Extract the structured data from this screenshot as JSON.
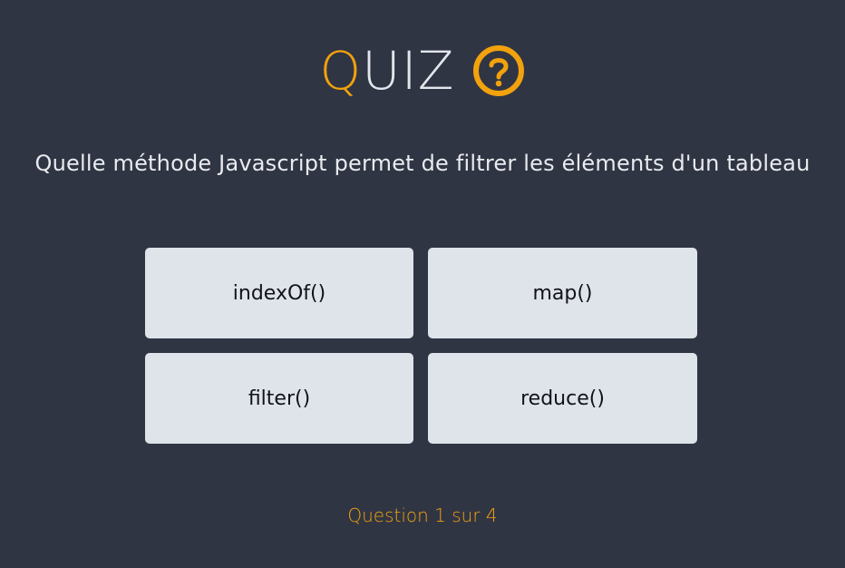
{
  "header": {
    "title_first_letter": "Q",
    "title_rest": "UIZ",
    "icon": "question-circle-icon"
  },
  "question": {
    "text": "Quelle méthode Javascript permet de filtrer les éléments d'un tableau"
  },
  "answers": [
    {
      "label": "indexOf()"
    },
    {
      "label": "map()"
    },
    {
      "label": "filter()"
    },
    {
      "label": "reduce()"
    }
  ],
  "progress": {
    "text": "Question 1 sur 4"
  },
  "colors": {
    "background": "#303544",
    "accent": "#f2a20c",
    "answer_background": "#dfe3ea",
    "text_light": "#e9ebef"
  }
}
